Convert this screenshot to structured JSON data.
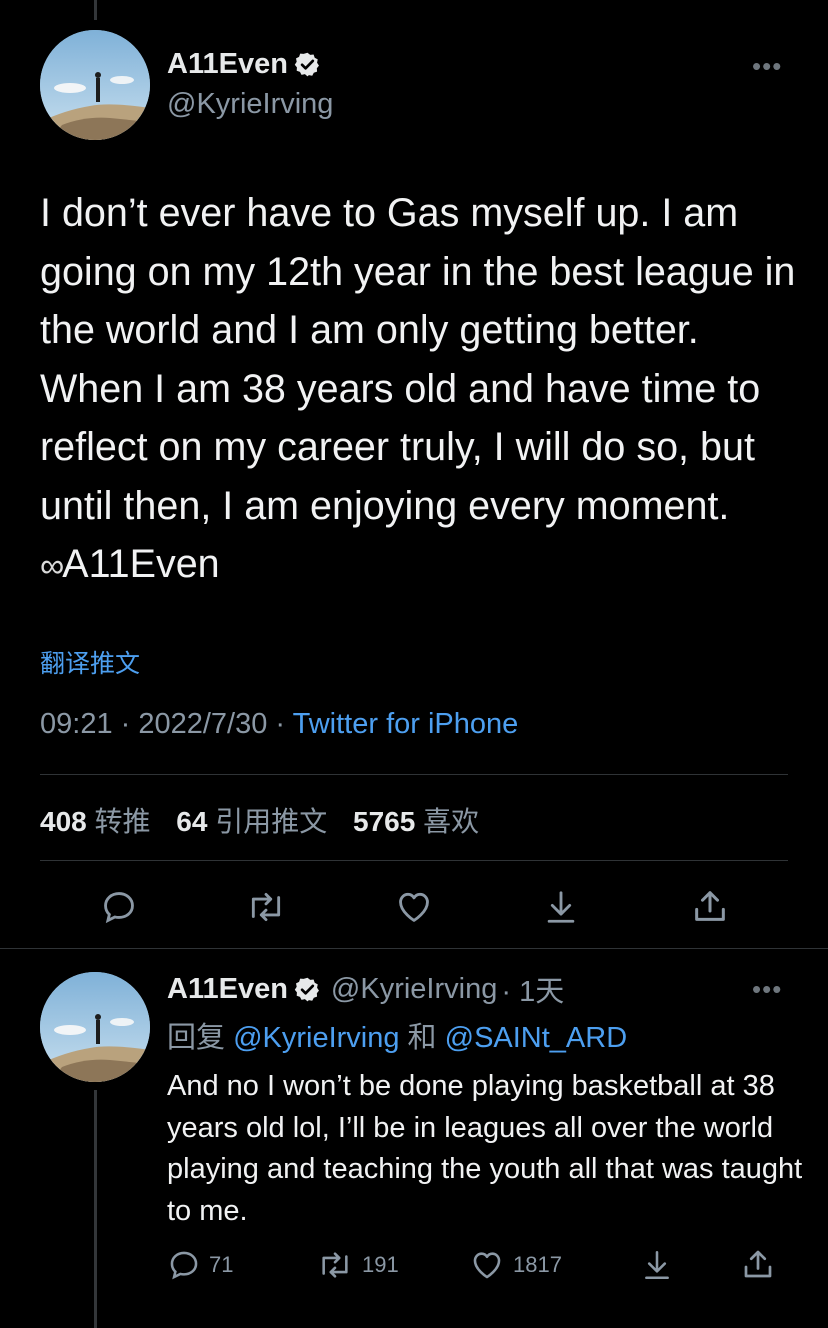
{
  "main_tweet": {
    "author_name": "A11Even",
    "author_handle": "@KyrieIrving",
    "text": "I don’t ever have to Gas myself up. I am going on my 12th year in the best league in the world and I am only getting better. When I am 38 years old and have time to reflect on my career truly, I will do so, but until then, I am enjoying every moment. ",
    "infinity_glyph": "∞",
    "text_tail": "A11Even",
    "translate_label": "翻译推文",
    "time": "09:21",
    "date": "2022/7/30",
    "separator": " · ",
    "source": "Twitter for iPhone",
    "retweets_count": "408",
    "retweets_label": "转推",
    "quotes_count": "64",
    "quotes_label": "引用推文",
    "likes_count": "5765",
    "likes_label": "喜欢"
  },
  "reply_tweet": {
    "author_name": "A11Even",
    "author_handle": "@KyrieIrving",
    "time_ago": "· 1天",
    "replying_prefix": "回复 ",
    "mention_1": "@KyrieIrving",
    "conjunction": " 和 ",
    "mention_2": "@SAINt_ARD",
    "text": "And no I won’t be done playing basketball at 38 years old lol, I’ll be in leagues all over the world playing and teaching the youth all that was taught to me.",
    "reply_count": "71",
    "retweet_count": "191",
    "like_count": "1817"
  },
  "icons": {
    "verified": "verified-badge-icon",
    "more": "more-icon",
    "reply": "reply-icon",
    "retweet": "retweet-icon",
    "like": "heart-icon",
    "bookmark": "bookmark-icon",
    "share": "share-icon"
  },
  "colors": {
    "background": "#000000",
    "text": "#e7e9ea",
    "secondary": "#8b98a5",
    "link": "#4d9ff0",
    "divider": "#2f3336"
  }
}
